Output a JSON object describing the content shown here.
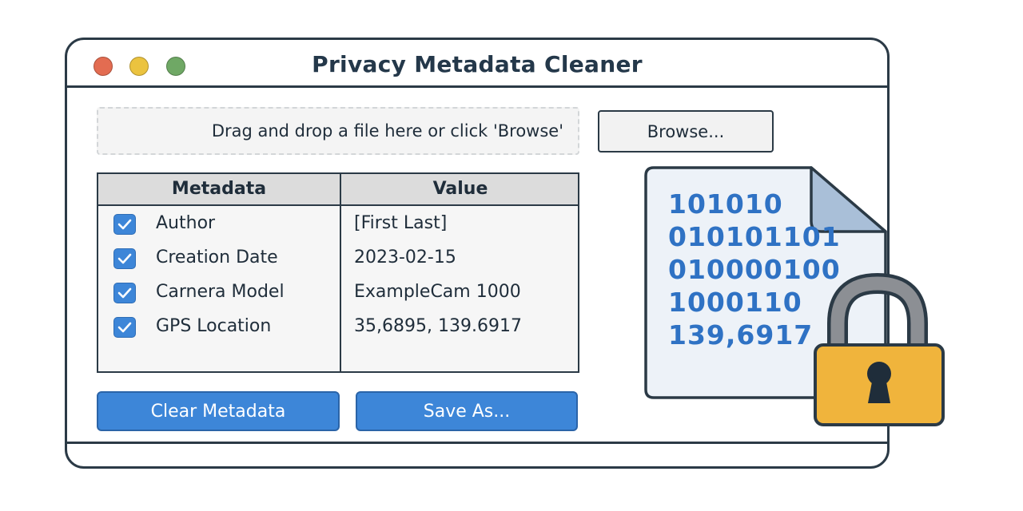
{
  "window": {
    "title": "Privacy Metadata Cleaner",
    "controls": {
      "close_color": "#e36c51",
      "minimize_color": "#ebc33f",
      "maximize_color": "#6fa865"
    }
  },
  "file_picker": {
    "dropzone_text": "Drag and drop a file here or click 'Browse'",
    "browse_label": "Browse..."
  },
  "metadata_table": {
    "columns": [
      "Metadata",
      "Value"
    ],
    "rows": [
      {
        "checked": true,
        "label": "Author",
        "value": "[First Last]"
      },
      {
        "checked": true,
        "label": "Creation Date",
        "value": "2023-02-15"
      },
      {
        "checked": true,
        "label": "Carnera Model",
        "value": "ExampleCam 1000"
      },
      {
        "checked": true,
        "label": "GPS Location",
        "value": "35,6895, 139.6917"
      }
    ]
  },
  "actions": {
    "clear_label": "Clear Metadata",
    "save_label": "Save As..."
  },
  "illustration": {
    "icons": [
      "document-icon",
      "padlock-icon"
    ],
    "binary_lines": [
      "101010",
      "010101101",
      "010000100",
      "1000110",
      "139,6917"
    ]
  },
  "colors": {
    "accent": "#3d86d8",
    "outline": "#2b3a46",
    "lock_body": "#f0b43c",
    "document_fill": "#edf2f8"
  }
}
